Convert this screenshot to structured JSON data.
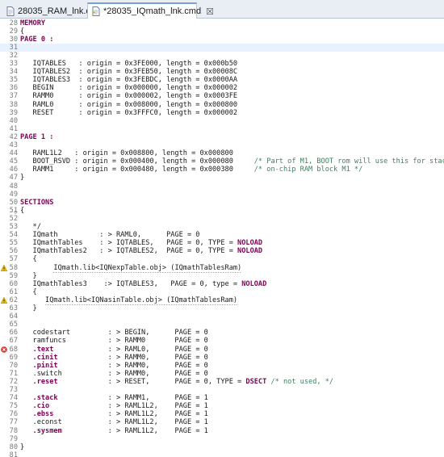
{
  "tabs": [
    {
      "label": "28035_RAM_lnk.cmd",
      "active": false
    },
    {
      "label": "*28035_IQmath_lnk.cmd",
      "active": true,
      "close": "☒"
    }
  ],
  "lines": [
    {
      "n": "28",
      "seg": [
        {
          "t": "MEMORY",
          "c": "kw"
        }
      ]
    },
    {
      "n": "29",
      "seg": [
        {
          "t": "{"
        }
      ]
    },
    {
      "n": "30",
      "seg": [
        {
          "t": "PAGE 0 :",
          "c": "kw"
        }
      ]
    },
    {
      "n": "31",
      "seg": [
        {
          "t": ""
        }
      ],
      "cur": true
    },
    {
      "n": "32",
      "seg": [
        {
          "t": ""
        }
      ]
    },
    {
      "n": "33",
      "seg": [
        {
          "t": "   IQTABLES   : origin = 0x3FE000, length = 0x000b50"
        }
      ]
    },
    {
      "n": "34",
      "seg": [
        {
          "t": "   IQTABLES2  : origin = 0x3FEB50, length = 0x00008C"
        }
      ]
    },
    {
      "n": "35",
      "seg": [
        {
          "t": "   IQTABLES3  : origin = 0x3FEBDC, length = 0x0000AA"
        }
      ]
    },
    {
      "n": "36",
      "seg": [
        {
          "t": "   BEGIN      : origin = 0x000000, length = 0x000002"
        }
      ]
    },
    {
      "n": "37",
      "seg": [
        {
          "t": "   RAMM0      : origin = 0x000002, length = 0x0003FE"
        }
      ]
    },
    {
      "n": "38",
      "seg": [
        {
          "t": "   RAML0      : origin = 0x008000, length = 0x000800"
        }
      ]
    },
    {
      "n": "39",
      "seg": [
        {
          "t": "   RESET      : origin = 0x3FFFC0, length = 0x000002"
        }
      ]
    },
    {
      "n": "40",
      "seg": [
        {
          "t": ""
        }
      ]
    },
    {
      "n": "41",
      "seg": [
        {
          "t": ""
        }
      ]
    },
    {
      "n": "42",
      "seg": [
        {
          "t": "PAGE 1 :",
          "c": "kw"
        }
      ]
    },
    {
      "n": "43",
      "seg": [
        {
          "t": ""
        }
      ]
    },
    {
      "n": "44",
      "seg": [
        {
          "t": "   RAML1L2   : origin = 0x008800, length = 0x000800"
        }
      ]
    },
    {
      "n": "45",
      "seg": [
        {
          "t": "   BOOT_RSVD : origin = 0x000400, length = 0x000080     "
        },
        {
          "t": "/* Part of M1, BOOT rom will use this for stack */",
          "c": "cm"
        }
      ]
    },
    {
      "n": "46",
      "seg": [
        {
          "t": "   RAMM1     : origin = 0x000480, length = 0x000380     "
        },
        {
          "t": "/* on-chip RAM block M1 */",
          "c": "cm"
        }
      ]
    },
    {
      "n": "47",
      "seg": [
        {
          "t": "}"
        }
      ]
    },
    {
      "n": "48",
      "seg": [
        {
          "t": ""
        }
      ]
    },
    {
      "n": "49",
      "seg": [
        {
          "t": ""
        }
      ]
    },
    {
      "n": "50",
      "seg": [
        {
          "t": "SECTIONS",
          "c": "kw"
        }
      ]
    },
    {
      "n": "51",
      "seg": [
        {
          "t": "{"
        }
      ],
      "fold": true
    },
    {
      "n": "52",
      "seg": [
        {
          "t": ""
        }
      ]
    },
    {
      "n": "53",
      "seg": [
        {
          "t": "   */"
        }
      ]
    },
    {
      "n": "54",
      "seg": [
        {
          "t": "   IQmath          : > RAML0,      PAGE = 0"
        }
      ]
    },
    {
      "n": "55",
      "seg": [
        {
          "t": "   IQmathTables    : > IQTABLES,   PAGE = 0, TYPE = "
        },
        {
          "t": "NOLOAD",
          "c": "kw"
        }
      ]
    },
    {
      "n": "56",
      "seg": [
        {
          "t": "   IQmathTables2   : > IQTABLES2,  PAGE = 0, TYPE = "
        },
        {
          "t": "NOLOAD",
          "c": "kw"
        }
      ]
    },
    {
      "n": "57",
      "seg": [
        {
          "t": "   {"
        }
      ]
    },
    {
      "n": "58",
      "seg": [
        {
          "t": "        "
        },
        {
          "t": "IQmath.lib<IQNexpTable.obj> (IQmathTablesRam)",
          "c": "hl"
        }
      ],
      "mark": "warn"
    },
    {
      "n": "59",
      "seg": [
        {
          "t": "   }"
        }
      ]
    },
    {
      "n": "60",
      "seg": [
        {
          "t": "   IQmathTables3    :> IQTABLES3,   PAGE = 0, type = "
        },
        {
          "t": "NOLOAD",
          "c": "kw"
        }
      ]
    },
    {
      "n": "61",
      "seg": [
        {
          "t": "   {"
        }
      ]
    },
    {
      "n": "62",
      "seg": [
        {
          "t": "      "
        },
        {
          "t": "IQmath.lib<IQNasinTable.obj> (IQmathTablesRam)",
          "c": "hl"
        }
      ],
      "mark": "warn"
    },
    {
      "n": "63",
      "seg": [
        {
          "t": "   }"
        }
      ]
    },
    {
      "n": "64",
      "seg": [
        {
          "t": ""
        }
      ]
    },
    {
      "n": "65",
      "seg": [
        {
          "t": ""
        }
      ]
    },
    {
      "n": "66",
      "seg": [
        {
          "t": "   codestart         : > BEGIN,      PAGE = 0"
        }
      ]
    },
    {
      "n": "67",
      "seg": [
        {
          "t": "   ramfuncs          : > RAMM0       PAGE = 0"
        }
      ]
    },
    {
      "n": "68",
      "seg": [
        {
          "t": "   "
        },
        {
          "t": ".text",
          "c": "kw"
        },
        {
          "t": "             : > RAML0,      PAGE = 0"
        }
      ],
      "mark": "err"
    },
    {
      "n": "69",
      "seg": [
        {
          "t": "   "
        },
        {
          "t": ".cinit",
          "c": "kw"
        },
        {
          "t": "            : > RAMM0,      PAGE = 0"
        }
      ]
    },
    {
      "n": "70",
      "seg": [
        {
          "t": "   "
        },
        {
          "t": ".pinit",
          "c": "kw"
        },
        {
          "t": "            : > RAMM0,      PAGE = 0"
        }
      ]
    },
    {
      "n": "71",
      "seg": [
        {
          "t": "   .switch           : > RAMM0,      PAGE = 0"
        }
      ]
    },
    {
      "n": "72",
      "seg": [
        {
          "t": "   "
        },
        {
          "t": ".reset",
          "c": "kw"
        },
        {
          "t": "            : > RESET,      PAGE = 0, TYPE = "
        },
        {
          "t": "DSECT",
          "c": "kw"
        },
        {
          "t": " "
        },
        {
          "t": "/* not used, */",
          "c": "cm"
        }
      ]
    },
    {
      "n": "73",
      "seg": [
        {
          "t": ""
        }
      ]
    },
    {
      "n": "74",
      "seg": [
        {
          "t": "   "
        },
        {
          "t": ".stack",
          "c": "kw"
        },
        {
          "t": "            : > RAMM1,      PAGE = 1"
        }
      ]
    },
    {
      "n": "75",
      "seg": [
        {
          "t": "   "
        },
        {
          "t": ".cio",
          "c": "kw"
        },
        {
          "t": "              : > RAML1L2,    PAGE = 1"
        }
      ]
    },
    {
      "n": "76",
      "seg": [
        {
          "t": "   "
        },
        {
          "t": ".ebss",
          "c": "kw"
        },
        {
          "t": "             : > RAML1L2,    PAGE = 1"
        }
      ]
    },
    {
      "n": "77",
      "seg": [
        {
          "t": "   .econst           : > RAML1L2,    PAGE = 1"
        }
      ]
    },
    {
      "n": "78",
      "seg": [
        {
          "t": "   "
        },
        {
          "t": ".sysmem",
          "c": "kw"
        },
        {
          "t": "           : > RAML1L2,    PAGE = 1"
        }
      ]
    },
    {
      "n": "79",
      "seg": [
        {
          "t": ""
        }
      ]
    },
    {
      "n": "80",
      "seg": [
        {
          "t": "}"
        }
      ]
    },
    {
      "n": "81",
      "seg": [
        {
          "t": ""
        }
      ]
    }
  ]
}
